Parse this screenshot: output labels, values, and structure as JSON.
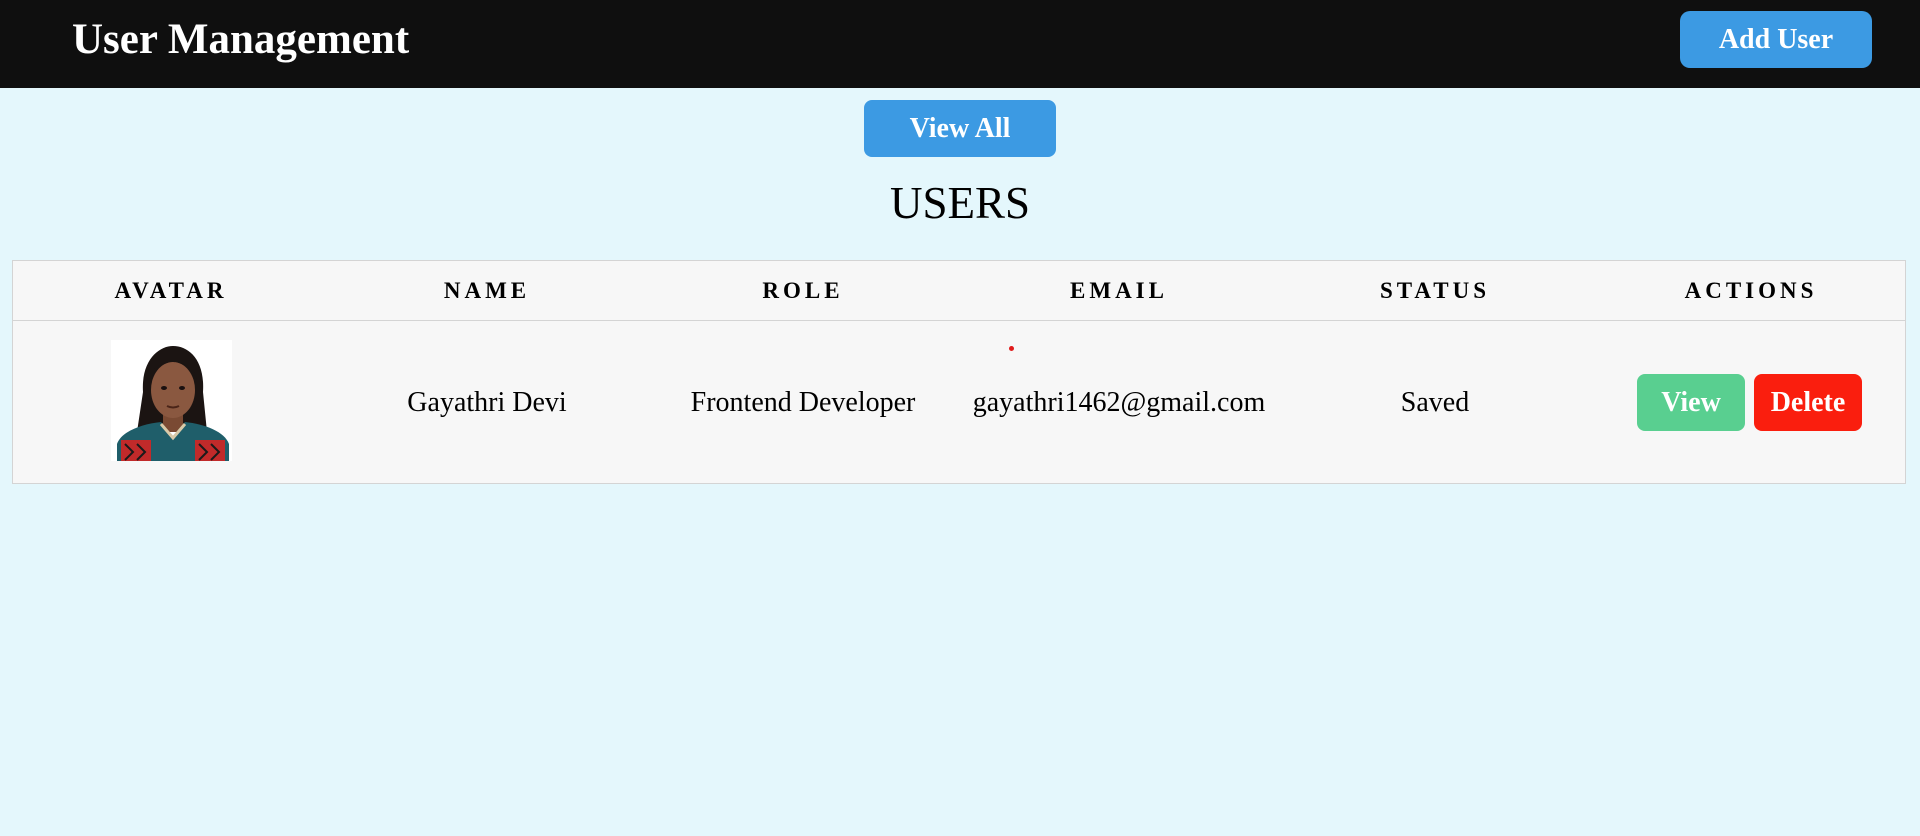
{
  "header": {
    "title": "User Management",
    "add_user_label": "Add User"
  },
  "toolbar": {
    "view_all_label": "View All"
  },
  "page": {
    "heading": "USERS"
  },
  "table": {
    "columns": [
      "AVATAR",
      "NAME",
      "ROLE",
      "EMAIL",
      "STATUS",
      "ACTIONS"
    ],
    "rows": [
      {
        "avatar": "user-avatar-photo",
        "name": "Gayathri Devi",
        "role": "Frontend Developer",
        "email": "gayathri1462@gmail.com",
        "status": "Saved",
        "view_label": "View",
        "delete_label": "Delete"
      }
    ]
  },
  "colors": {
    "navbar_bg": "#0f0f0f",
    "page_bg": "#e4f7fc",
    "primary_button": "#3c9ae3",
    "view_button": "#59cf90",
    "delete_button": "#fa1e0e"
  }
}
